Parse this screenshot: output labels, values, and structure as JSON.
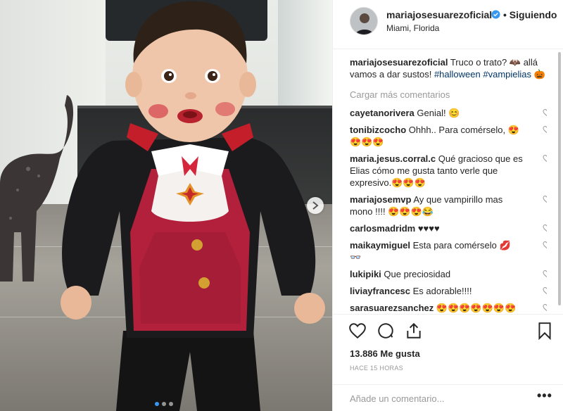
{
  "post": {
    "username": "mariajosesuarezoficial",
    "follow_label": "• Siguiendo",
    "location": "Miami, Florida",
    "caption_user": "mariajosesuarezoficial",
    "caption_text": " Truco o trato? 🦇 allá vamos a dar sustos! ",
    "caption_tags": [
      "#halloween",
      "#vampielias"
    ],
    "caption_end": " 🎃",
    "load_more": "Cargar más comentarios",
    "likes": "13.886 Me gusta",
    "time": "HACE 15 HORAS",
    "comment_placeholder": "Añade un comentario...",
    "more_label": "•••"
  },
  "comments": [
    {
      "user": "cayetanorivera",
      "text": " Genial! 😊"
    },
    {
      "user": "tonibizcocho",
      "text": " Ohhh.. Para comérselo, 😍😍😍😍"
    },
    {
      "user": "maria.jesus.corral.c",
      "text": " Qué gracioso que es Elias cómo me gusta tanto verle que expresivo.😍😍😍"
    },
    {
      "user": "mariajosemvp",
      "text": " Ay que vampirillo mas mono !!!! 😍😍😍😂"
    },
    {
      "user": "carlosmadridm",
      "text": " ♥♥♥♥"
    },
    {
      "user": "maikaymiguel",
      "text": " Esta para comérselo 💋 👓"
    },
    {
      "user": "lukipiki",
      "text": " Que preciosidad"
    },
    {
      "user": "liviayfrancesc",
      "text": " Es adorable!!!!"
    },
    {
      "user": "sarasuarezsanchez",
      "text": " 😍😍😍😍😍😍😍😍"
    }
  ],
  "colors": {
    "accent": "#3897f0",
    "hashtag": "#003569",
    "muted": "#999999"
  },
  "icons": [
    "verified-icon",
    "heart-icon",
    "comment-icon",
    "share-icon",
    "bookmark-icon",
    "chevron-right-icon",
    "more-icon"
  ]
}
